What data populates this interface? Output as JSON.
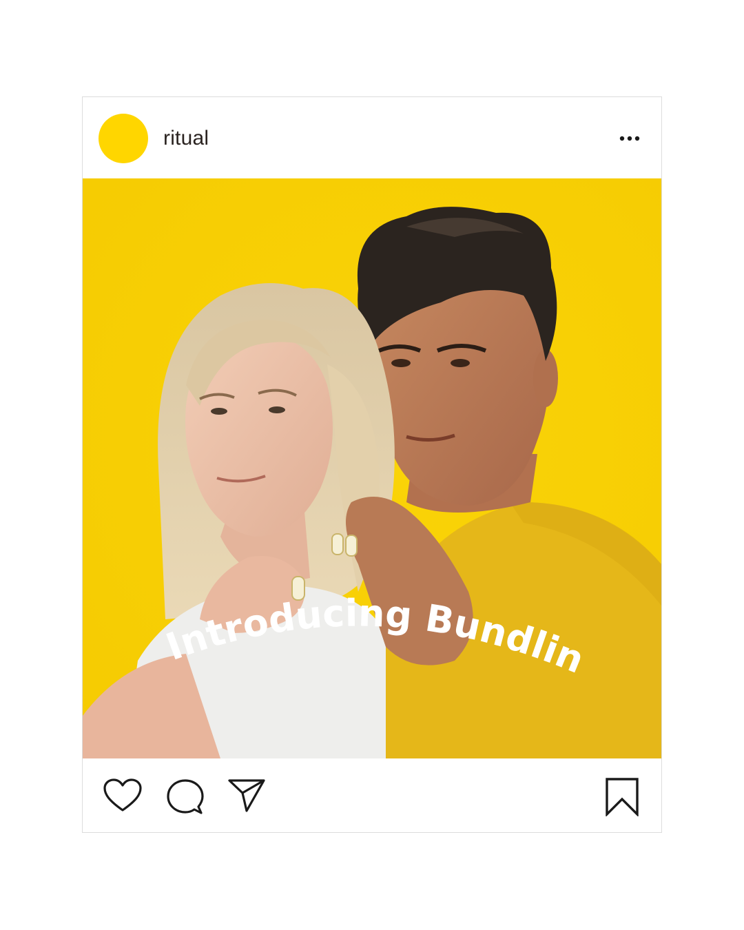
{
  "account": {
    "username": "ritual",
    "avatar_color": "#FFD600"
  },
  "post": {
    "image_overlay_text": "Introducing Bundling",
    "background_color": "#F9D104",
    "icons": {
      "more": "more-horizontal-icon",
      "like": "heart-icon",
      "comment": "comment-bubble-icon",
      "share": "paper-plane-icon",
      "save": "bookmark-icon"
    }
  }
}
